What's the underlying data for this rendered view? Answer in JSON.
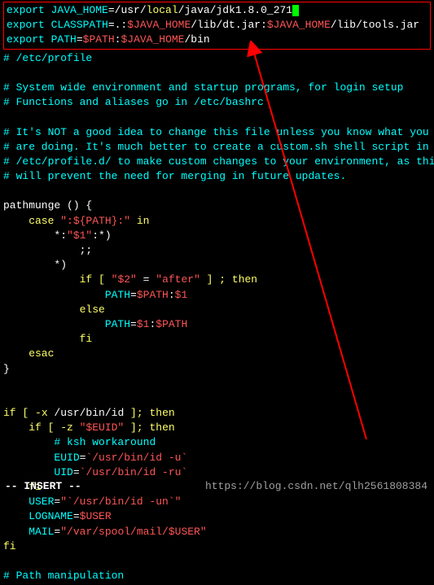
{
  "highlighted": {
    "l1_export": "export",
    "l1_var": " JAVA_HOME",
    "l1_eq": "=",
    "l1_p1": "/usr/",
    "l1_p2": "local",
    "l1_p3": "/java/jdk1.8.0_271",
    "l2_export": "export",
    "l2_var": " CLASSPATH",
    "l2_eq": "=.:",
    "l2_v1": "$JAVA_HOME",
    "l2_p1": "/lib/dt.jar:",
    "l2_v2": "$JAVA_HOME",
    "l2_p2": "/lib/tools.jar",
    "l3_export": "export",
    "l3_var": " PATH",
    "l3_eq": "=",
    "l3_v1": "$PATH",
    "l3_colon": ":",
    "l3_v2": "$JAVA_HOME",
    "l3_p1": "/bin"
  },
  "comments": {
    "etc": "# /etc/profile",
    "c1": "# System wide environment and startup programs, for login setup",
    "c2": "# Functions and aliases go in /etc/bashrc",
    "c3": "# It's NOT a good idea to change this file unless you know what you",
    "c4": "# are doing. It's much better to create a custom.sh shell script in",
    "c5": "# /etc/profile.d/ to make custom changes to your environment, as this",
    "c6": "# will prevent the need for merging in future updates.",
    "pathman": "# Path manipulation",
    "ksh": "# ksh workaround"
  },
  "code": {
    "pm1": "pathmunge ",
    "pm2": "()",
    "pm3": " {",
    "case": "    case ",
    "caseval": "\":${PATH}:\"",
    "casein": " in",
    "pat1a": "        *:",
    "pat1b": "\"$1\"",
    "pat1c": ":*)",
    "dsemi": "            ;;",
    "star": "        *)",
    "if1a": "            if ",
    "if1b": "[ ",
    "if1c": "\"$2\"",
    "if1d": " = ",
    "if1e": "\"after\"",
    "if1f": " ]",
    "if1g": " ; then",
    "pa1a": "                PATH",
    "pa1b": "=",
    "pa1c": "$PATH",
    "pa1d": ":",
    "pa1e": "$1",
    "else": "            else",
    "pa2a": "                PATH",
    "pa2b": "=",
    "pa2c": "$1",
    "pa2d": ":",
    "pa2e": "$PATH",
    "fi1": "            fi",
    "esac": "    esac",
    "brace": "}",
    "if2a": "if ",
    "if2b": "[ ",
    "if2c": "-x",
    "if2d": " /usr/bin/id ",
    "if2e": "]",
    "if2f": "; then",
    "if3a": "    if ",
    "if3b": "[ ",
    "if3c": "-z",
    "if3d": " ",
    "if3e": "\"$EUID\"",
    "if3f": " ]",
    "if3g": "; then",
    "euid1": "        EUID",
    "euid2": "=",
    "euid3": "`/usr/bin/id -u`",
    "uid1": "        UID",
    "uid2": "=",
    "uid3": "`/usr/bin/id -ru`",
    "fi2": "    fi",
    "user1": "    USER",
    "user2": "=",
    "user3": "\"`/usr/bin/id -un`\"",
    "log1": "    LOGNAME",
    "log2": "=",
    "log3": "$USER",
    "mail1": "    MAIL",
    "mail2": "=",
    "mail3": "\"/var/spool/mail/$USER\"",
    "fi3": "fi"
  },
  "mode": "-- INSERT --",
  "watermark": "https://blog.csdn.net/qlh2561808384"
}
